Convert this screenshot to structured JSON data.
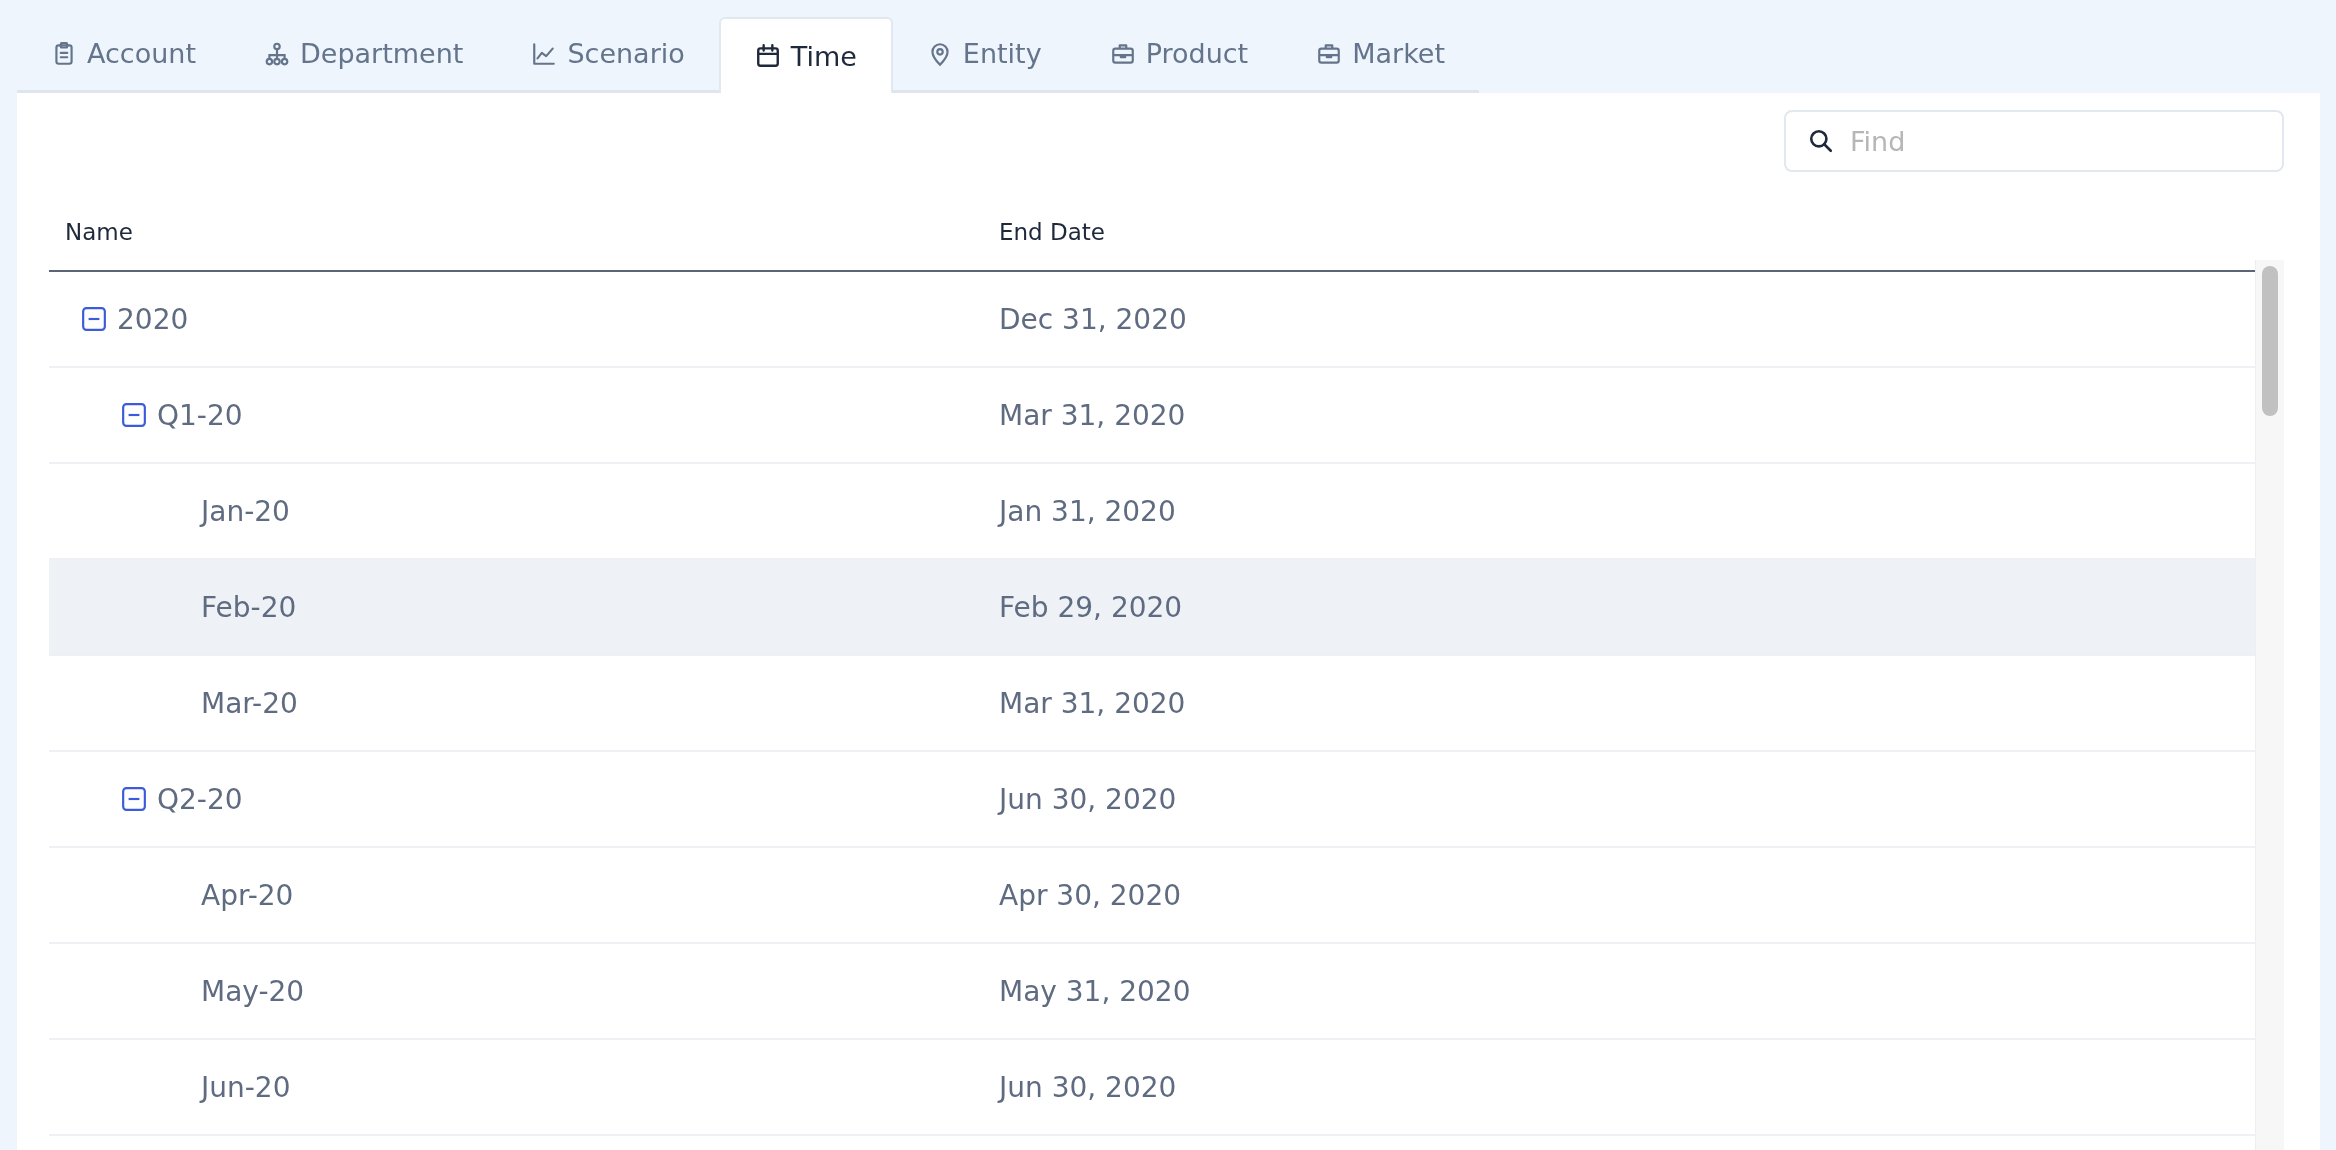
{
  "tabs": [
    {
      "label": "Account",
      "selected": false
    },
    {
      "label": "Department",
      "selected": false
    },
    {
      "label": "Scenario",
      "selected": false
    },
    {
      "label": "Time",
      "selected": true
    },
    {
      "label": "Entity",
      "selected": false
    },
    {
      "label": "Product",
      "selected": false
    },
    {
      "label": "Market",
      "selected": false
    }
  ],
  "search": {
    "placeholder": "Find"
  },
  "table": {
    "columns": [
      "Name",
      "End Date"
    ],
    "rows": [
      {
        "name": "2020",
        "end_date": "Dec 31, 2020",
        "expanded": true,
        "selected": false,
        "children": [
          {
            "name": "Q1-20",
            "end_date": "Mar 31, 2020",
            "expanded": true,
            "selected": false,
            "children": [
              {
                "name": "Jan-20",
                "end_date": "Jan 31, 2020",
                "selected": false
              },
              {
                "name": "Feb-20",
                "end_date": "Feb 29, 2020",
                "selected": true
              },
              {
                "name": "Mar-20",
                "end_date": "Mar 31, 2020",
                "selected": false
              }
            ]
          },
          {
            "name": "Q2-20",
            "end_date": "Jun 30, 2020",
            "expanded": true,
            "selected": false,
            "children": [
              {
                "name": "Apr-20",
                "end_date": "Apr 30, 2020",
                "selected": false
              },
              {
                "name": "May-20",
                "end_date": "May 31, 2020",
                "selected": false
              },
              {
                "name": "Jun-20",
                "end_date": "Jun 30, 2020",
                "selected": false
              }
            ]
          }
        ]
      }
    ]
  }
}
